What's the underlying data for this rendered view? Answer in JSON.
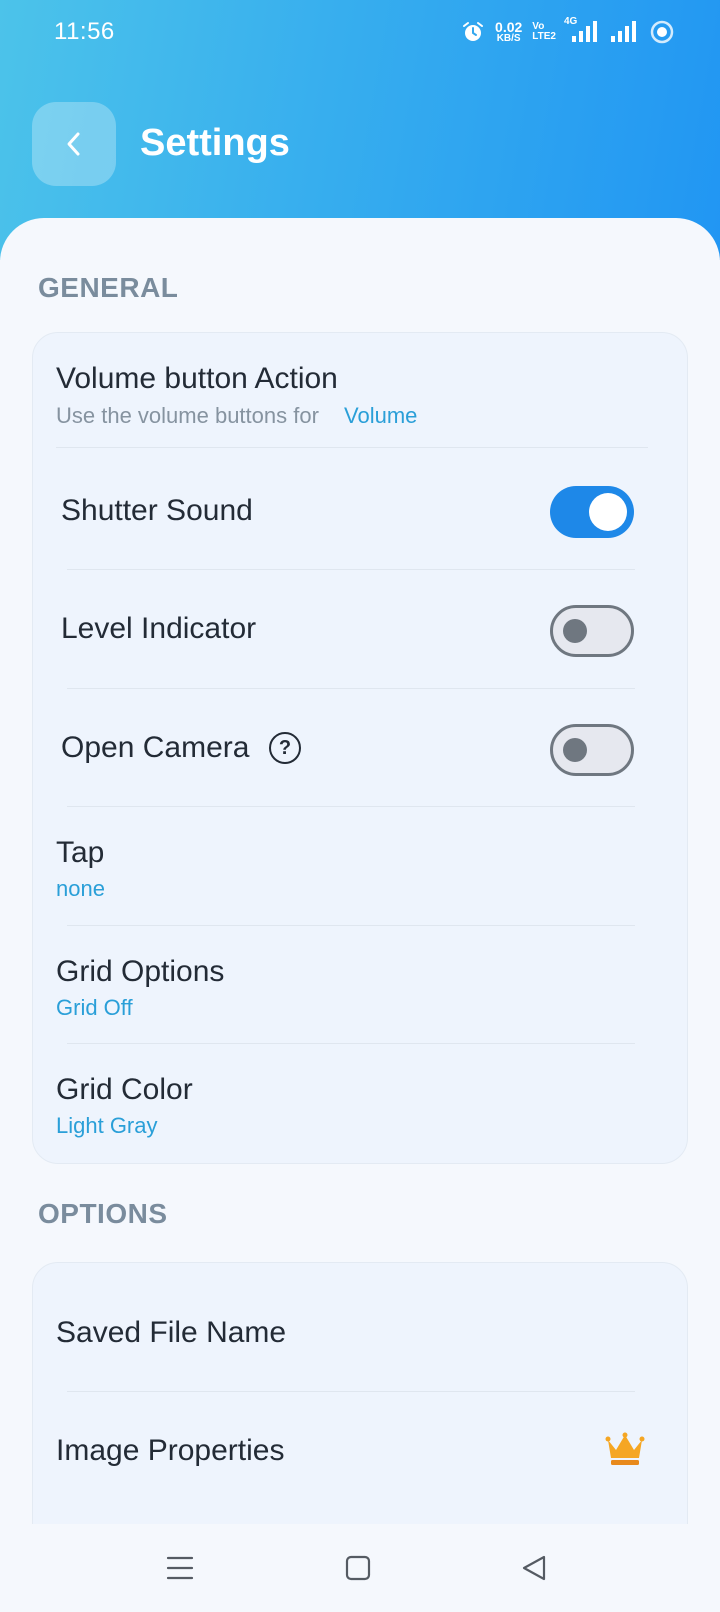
{
  "status_bar": {
    "time": "11:56",
    "speed_value": "0.02",
    "speed_unit": "KB/S",
    "volte_top": "Vo",
    "volte_bottom": "LTE2",
    "network": "4G",
    "icons": [
      "alarm-icon",
      "signal-4g-icon",
      "signal-icon",
      "hotspot-icon"
    ]
  },
  "header": {
    "title": "Settings",
    "back_icon": "chevron-left-icon"
  },
  "general": {
    "section_title": "GENERAL",
    "volume_action": {
      "title": "Volume button Action",
      "subtitle": "Use the volume buttons for",
      "value": "Volume"
    },
    "shutter_sound": {
      "title": "Shutter Sound",
      "enabled": true
    },
    "level_indicator": {
      "title": "Level Indicator",
      "enabled": false
    },
    "open_camera": {
      "title": "Open Camera",
      "help": "?",
      "enabled": false
    },
    "tap": {
      "title": "Tap",
      "value": "none"
    },
    "grid_options": {
      "title": "Grid Options",
      "value": "Grid Off"
    },
    "grid_color": {
      "title": "Grid Color",
      "value": "Light Gray"
    }
  },
  "options": {
    "section_title": "OPTIONS",
    "saved_file_name": {
      "title": "Saved File Name"
    },
    "image_properties": {
      "title": "Image Properties",
      "badge_icon": "crown-icon"
    }
  },
  "nav_bar": {
    "icons": [
      "menu-icon",
      "home-square-icon",
      "back-triangle-icon"
    ]
  },
  "colors": {
    "header_gradient_start": "#4cc3ea",
    "header_gradient_end": "#2196f3",
    "accent": "#1e88e8",
    "link_blue": "#2a9fd8",
    "section_gray": "#7a8c9d",
    "crown": "#f5a623"
  }
}
